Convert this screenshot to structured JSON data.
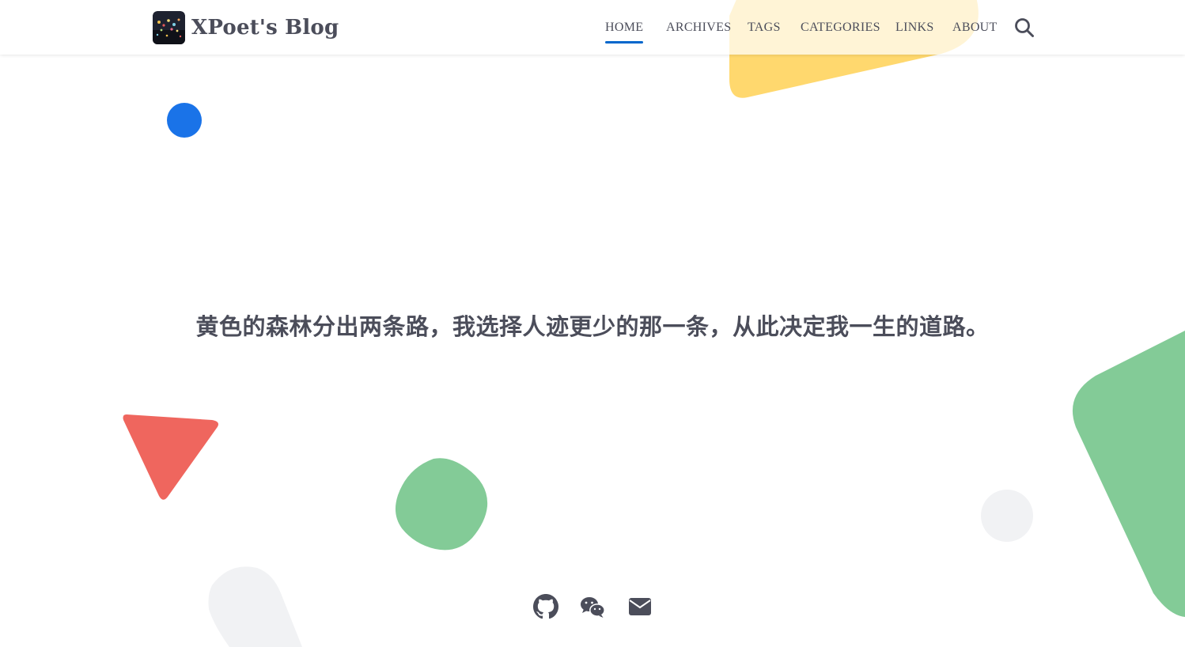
{
  "header": {
    "site_title": "XPoet's Blog",
    "nav": [
      {
        "label": "HOME",
        "active": true
      },
      {
        "label": "ARCHIVES",
        "active": false
      },
      {
        "label": "TAGS",
        "active": false
      },
      {
        "label": "CATEGORIES",
        "active": false
      },
      {
        "label": "LINKS",
        "active": false
      },
      {
        "label": "ABOUT",
        "active": false
      }
    ],
    "search_icon": "search-icon",
    "active_underline_color": "#0066cc"
  },
  "hero": {
    "motto": "黄色的森林分出两条路，我选择人迹更少的那一条，从此决定我一生的道路。"
  },
  "social": {
    "icons": [
      "github-icon",
      "wechat-icon",
      "email-icon"
    ]
  },
  "colors": {
    "text": "#4b4d5a",
    "accent_blue": "#1a73e8",
    "shape_yellow": "#ffd666",
    "shape_green": "#83cb97",
    "shape_red": "#ef665e",
    "shape_gray": "#f1f2f4"
  }
}
